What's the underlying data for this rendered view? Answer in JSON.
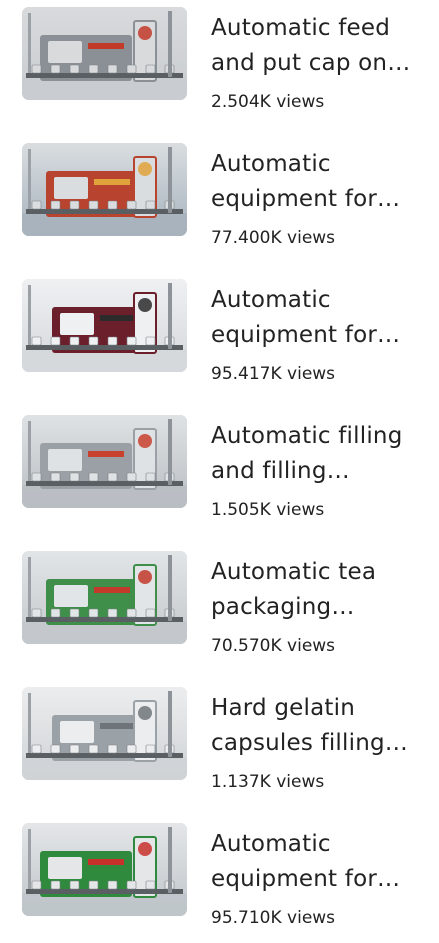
{
  "items": [
    {
      "title": "Automatic feed and put cap on machine",
      "views_label": "2.504K views",
      "thumbnail": "capping-machine-image",
      "palette": {
        "bg": "#c9ccd0",
        "base": "#8a9096",
        "accent": "#d8dadc",
        "highlight": "#c23a2a"
      }
    },
    {
      "title": "Automatic equipment for packaging",
      "views_label": "77.400K views",
      "thumbnail": "packaging-machine-image",
      "palette": {
        "bg": "#a7b3bd",
        "base": "#b8432e",
        "accent": "#d9dde0",
        "highlight": "#e0a23a"
      }
    },
    {
      "title": "Automatic equipment for testing",
      "views_label": "95.417K views",
      "thumbnail": "tablet-tester-image",
      "palette": {
        "bg": "#d5d8db",
        "base": "#6b1f2a",
        "accent": "#eef0f2",
        "highlight": "#2b2b2b"
      }
    },
    {
      "title": "Automatic filling and filling machine",
      "views_label": "1.505K views",
      "thumbnail": "filling-machine-image",
      "palette": {
        "bg": "#b9bec3",
        "base": "#9aa0a6",
        "accent": "#dfe2e4",
        "highlight": "#c8402e"
      }
    },
    {
      "title": "Automatic tea packaging machine",
      "views_label": "70.570K views",
      "thumbnail": "tea-packaging-machine-image",
      "palette": {
        "bg": "#c3c8cc",
        "base": "#3f8f4a",
        "accent": "#e2e5e7",
        "highlight": "#c23a2a"
      }
    },
    {
      "title": "Hard gelatin capsules filling machine",
      "views_label": "1.137K views",
      "thumbnail": "capsule-filling-machine-image",
      "palette": {
        "bg": "#cfd3d6",
        "base": "#9aa1a7",
        "accent": "#ecedee",
        "highlight": "#6e7479"
      }
    },
    {
      "title": "Automatic equipment for labeling",
      "views_label": "95.710K views",
      "thumbnail": "labeling-machine-image",
      "palette": {
        "bg": "#bfc5ca",
        "base": "#2f8a3e",
        "accent": "#e4e6e8",
        "highlight": "#c8302a"
      }
    }
  ]
}
